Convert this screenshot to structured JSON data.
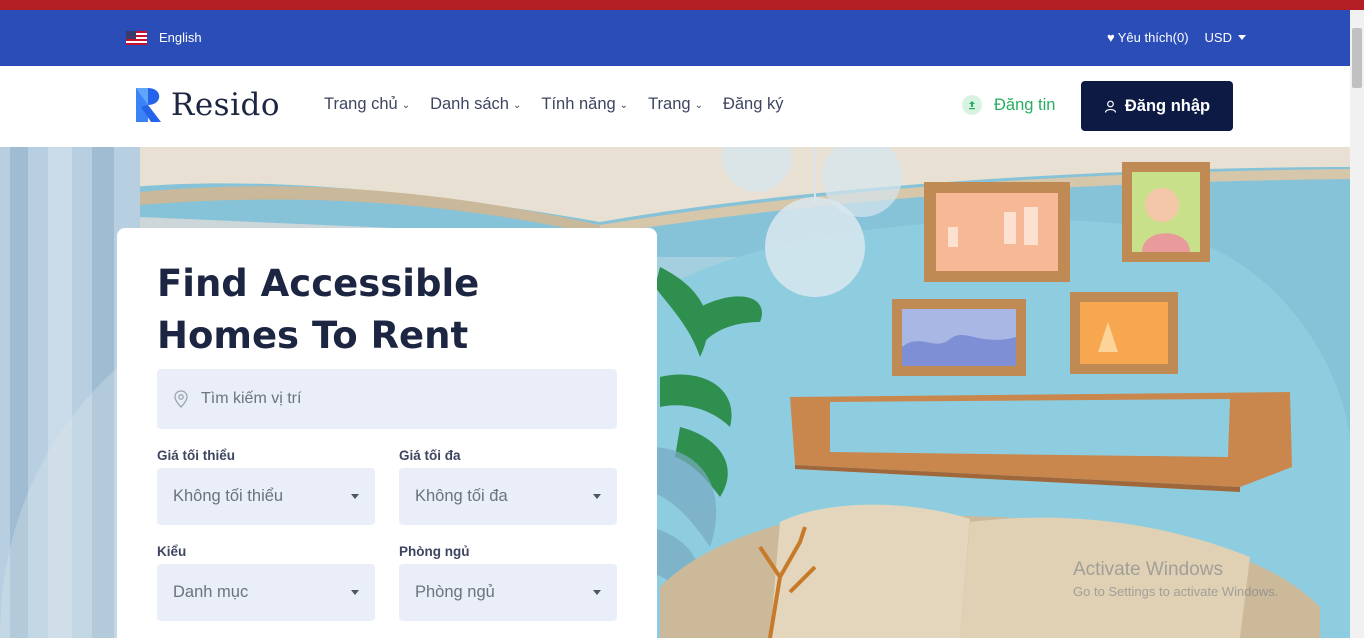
{
  "topbar": {
    "language": "English",
    "favorites": "Yêu thích(0)",
    "currency": "USD"
  },
  "header": {
    "logo_text": "Resido",
    "nav": [
      {
        "label": "Trang chủ"
      },
      {
        "label": "Danh sách"
      },
      {
        "label": "Tính năng"
      },
      {
        "label": "Trang"
      },
      {
        "label": "Đăng ký"
      }
    ],
    "post_label": "Đăng tin",
    "login_label": "Đăng nhập"
  },
  "hero": {
    "title_line1": "Find Accessible",
    "title_line2": "Homes To Rent",
    "search_placeholder": "Tìm kiếm vị trí",
    "min_price_label": "Giá tối thiểu",
    "min_price_value": "Không tối thiểu",
    "max_price_label": "Giá tối đa",
    "max_price_value": "Không tối đa",
    "type_label": "Kiểu",
    "type_value": "Danh mục",
    "bedrooms_label": "Phòng ngủ",
    "bedrooms_value": "Phòng ngủ"
  },
  "watermark": {
    "line1": "Activate Windows",
    "line2": "Go to Settings to activate Windows."
  },
  "colors": {
    "top_strip": "#b21e23",
    "utility_bar": "#2b4db8",
    "primary_dark": "#0c1a44",
    "accent_green": "#27ae60",
    "input_bg": "#eaeef8"
  }
}
